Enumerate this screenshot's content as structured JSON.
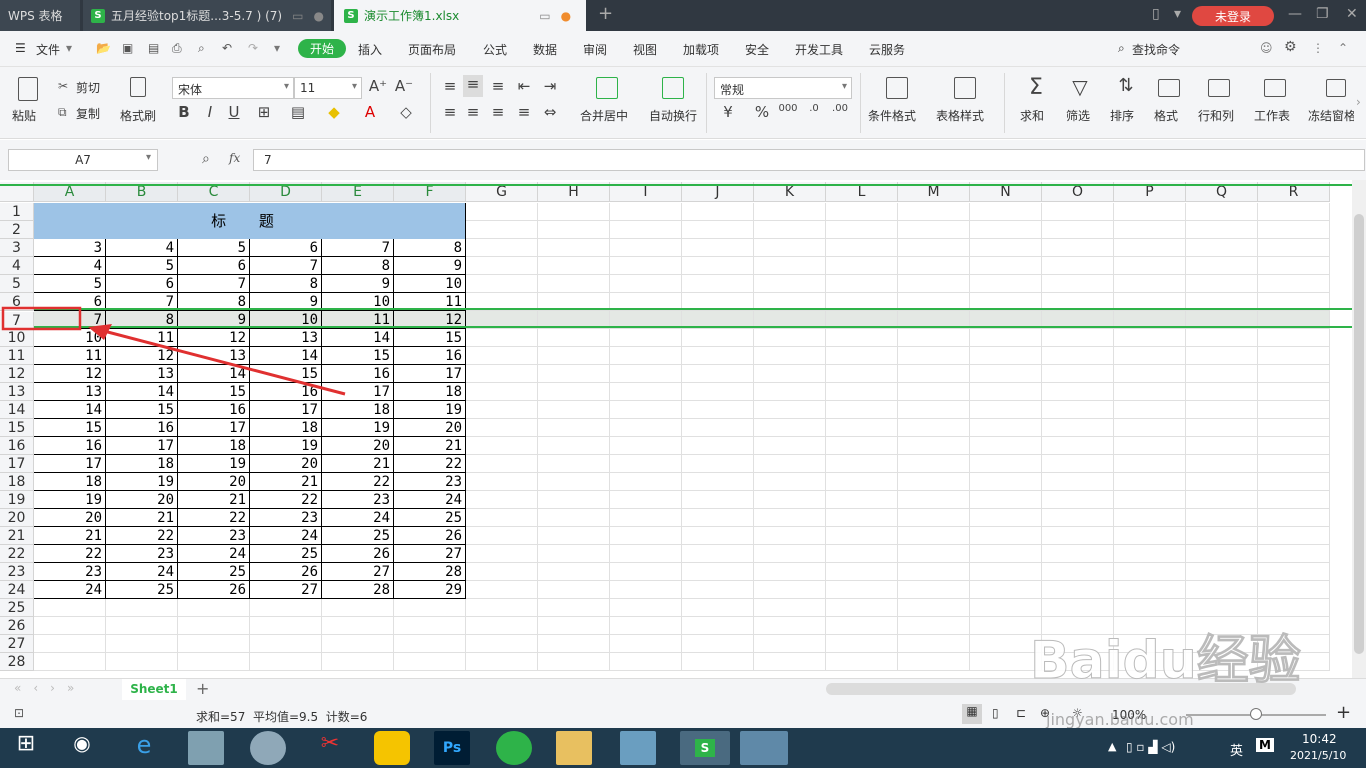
{
  "tabs": [
    {
      "label": "WPS 表格"
    },
    {
      "label": "五月经验top1标题...3-5.7 ) (7)"
    },
    {
      "label": "演示工作簿1.xlsx"
    }
  ],
  "login": "未登录",
  "menu": {
    "file": "文件",
    "items": [
      "开始",
      "插入",
      "页面布局",
      "公式",
      "数据",
      "审阅",
      "视图",
      "加载项",
      "安全",
      "开发工具",
      "云服务"
    ],
    "search": "查找命令"
  },
  "ribbon": {
    "paste": "粘贴",
    "cut": "剪切",
    "copy": "复制",
    "format_painter": "格式刷",
    "font": "宋体",
    "size": "11",
    "merge": "合并居中",
    "wrap": "自动换行",
    "number_format": "常规",
    "cond_format": "条件格式",
    "table_style": "表格样式",
    "sum": "求和",
    "filter": "筛选",
    "sort": "排序",
    "format": "格式",
    "rowcol": "行和列",
    "sheet": "工作表",
    "freeze": "冻结窗格"
  },
  "formula_bar": {
    "cell": "A7",
    "fx": "fx",
    "value": "7"
  },
  "columns": [
    "A",
    "B",
    "C",
    "D",
    "E",
    "F",
    "G",
    "H",
    "I",
    "J",
    "K",
    "L",
    "M",
    "N",
    "O",
    "P",
    "Q",
    "R"
  ],
  "title_cell": "标 题",
  "row_labels": [
    "1",
    "2",
    "3",
    "4",
    "5",
    "6",
    "7",
    "10",
    "11",
    "12",
    "13",
    "14",
    "15",
    "16",
    "17",
    "18",
    "19",
    "20",
    "21",
    "22",
    "23",
    "24",
    "25",
    "26",
    "27",
    "28"
  ],
  "table": [
    [
      "3",
      "4",
      "5",
      "6",
      "7",
      "8"
    ],
    [
      "4",
      "5",
      "6",
      "7",
      "8",
      "9"
    ],
    [
      "5",
      "6",
      "7",
      "8",
      "9",
      "10"
    ],
    [
      "6",
      "7",
      "8",
      "9",
      "10",
      "11"
    ],
    [
      "",
      "7",
      "8",
      "9",
      "10",
      "11",
      "12"
    ],
    [
      "10",
      "11",
      "12",
      "13",
      "14",
      "15"
    ],
    [
      "11",
      "12",
      "13",
      "14",
      "15",
      "16"
    ],
    [
      "12",
      "13",
      "14",
      "15",
      "16",
      "17"
    ],
    [
      "13",
      "14",
      "15",
      "16",
      "17",
      "18"
    ],
    [
      "14",
      "15",
      "16",
      "17",
      "18",
      "19"
    ],
    [
      "15",
      "16",
      "17",
      "18",
      "19",
      "20"
    ],
    [
      "16",
      "17",
      "18",
      "19",
      "20",
      "21"
    ],
    [
      "17",
      "18",
      "19",
      "20",
      "21",
      "22"
    ],
    [
      "18",
      "19",
      "20",
      "21",
      "22",
      "23"
    ],
    [
      "19",
      "20",
      "21",
      "22",
      "23",
      "24"
    ],
    [
      "20",
      "21",
      "22",
      "23",
      "24",
      "25"
    ],
    [
      "21",
      "22",
      "23",
      "24",
      "25",
      "26"
    ],
    [
      "22",
      "23",
      "24",
      "25",
      "26",
      "27"
    ],
    [
      "23",
      "24",
      "25",
      "26",
      "27",
      "28"
    ],
    [
      "24",
      "25",
      "26",
      "27",
      "28",
      "29"
    ]
  ],
  "sheet": {
    "name": "Sheet1",
    "add": "+"
  },
  "status": {
    "text": "求和=57  平均值=9.5  计数=6",
    "zoom": "100%"
  },
  "taskbar": {
    "time": "10:42",
    "date": "2021/5/10",
    "ime": "英",
    "m": "M"
  },
  "watermark": {
    "text": "Baidu经验",
    "url": "jingyan.baidu.com"
  },
  "colors": {
    "accent": "#2eb349",
    "title_fill": "#9dc3e6",
    "highlight": "#e03030"
  }
}
